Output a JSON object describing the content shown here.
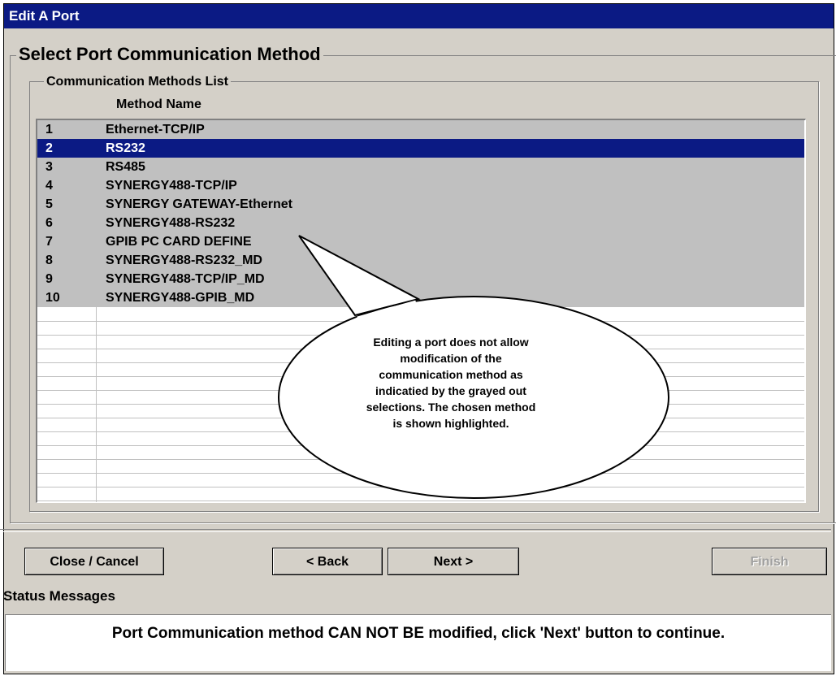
{
  "window": {
    "title": "Edit A Port"
  },
  "groups": {
    "outer_title": "Select Port Communication Method",
    "inner_title": "Communication  Methods List"
  },
  "list": {
    "column_header": "Method Name",
    "selected_index": 1,
    "items": [
      {
        "num": "1",
        "name": "Ethernet-TCP/IP"
      },
      {
        "num": "2",
        "name": "RS232"
      },
      {
        "num": "3",
        "name": "RS485"
      },
      {
        "num": "4",
        "name": "SYNERGY488-TCP/IP"
      },
      {
        "num": "5",
        "name": "SYNERGY GATEWAY-Ethernet"
      },
      {
        "num": "6",
        "name": "SYNERGY488-RS232"
      },
      {
        "num": "7",
        "name": "GPIB PC CARD DEFINE"
      },
      {
        "num": "8",
        "name": "SYNERGY488-RS232_MD"
      },
      {
        "num": "9",
        "name": "SYNERGY488-TCP/IP_MD"
      },
      {
        "num": "10",
        "name": "SYNERGY488-GPIB_MD"
      }
    ]
  },
  "buttons": {
    "close": "Close / Cancel",
    "back": "< Back",
    "next": "Next >",
    "finish": "Finish"
  },
  "status": {
    "label": "Status Messages",
    "message": "Port Communication method CAN NOT BE modified, click 'Next' button to continue."
  },
  "callout": {
    "lines": [
      "Editing a port does not allow",
      "modification of the",
      "communication method as",
      "indicatied by the grayed out",
      "selections.  The chosen method",
      "is shown highlighted."
    ]
  },
  "colors": {
    "title_bar": "#0b1a84",
    "selection": "#0b1a84",
    "disabled_row": "#c0c0c0",
    "face": "#d4d0c8"
  }
}
